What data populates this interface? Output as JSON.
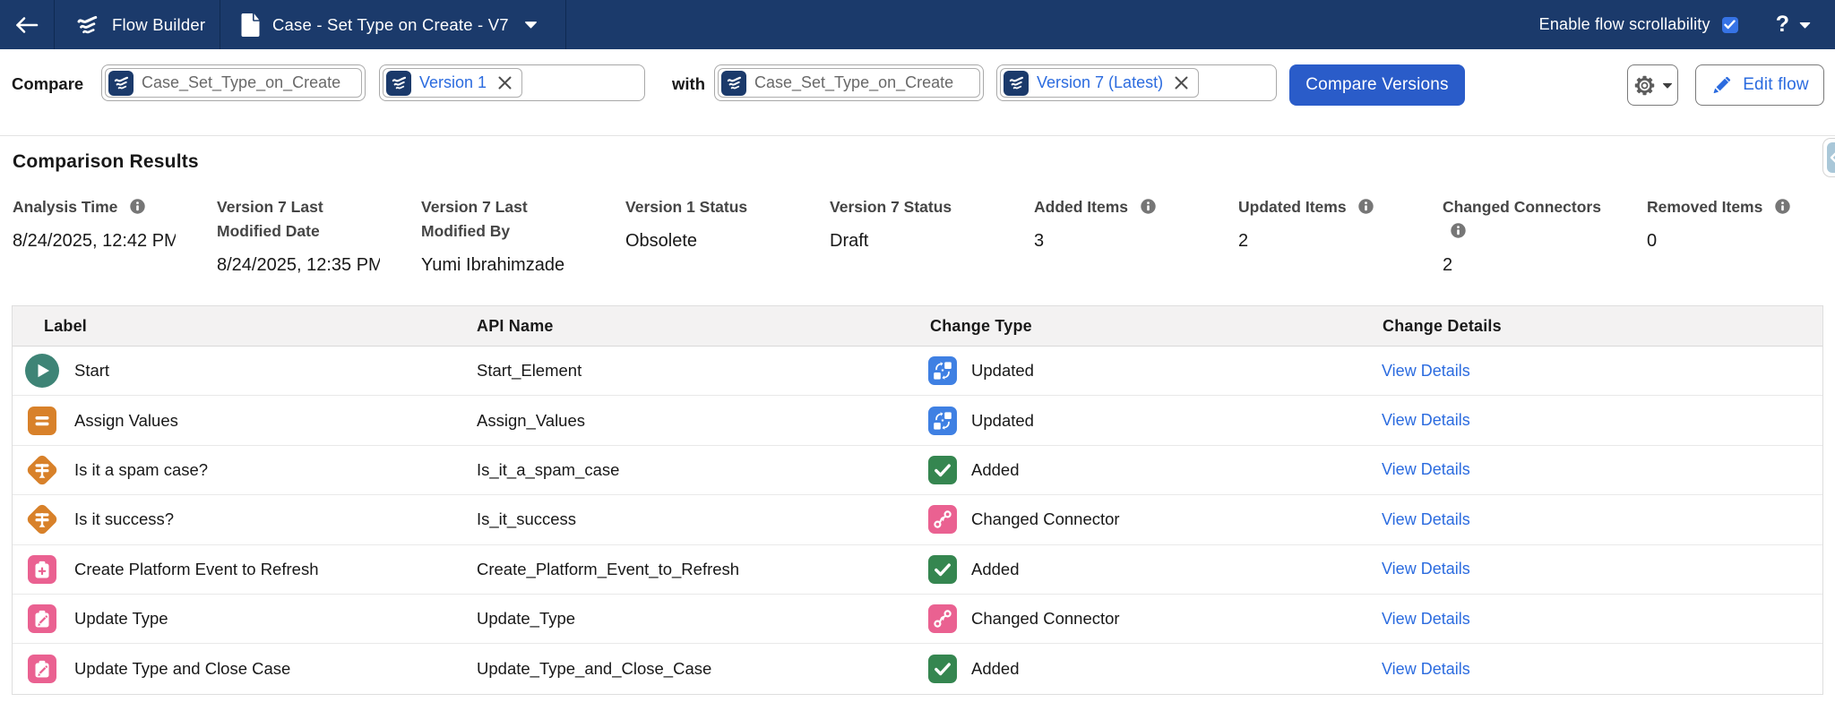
{
  "navbar": {
    "app_name": "Flow Builder",
    "flow_title": "Case - Set Type on Create - V7",
    "scrollability_label": "Enable flow scrollability",
    "scrollability_checked": true,
    "help_label": "?"
  },
  "toolbar": {
    "compare_label": "Compare",
    "with_label": "with",
    "flow_select_1": "Case_Set_Type_on_Create",
    "version_select_1": "Version 1",
    "flow_select_2": "Case_Set_Type_on_Create",
    "version_select_2": "Version 7 (Latest)",
    "compare_button": "Compare Versions",
    "edit_flow_button": "Edit flow"
  },
  "results": {
    "title": "Comparison Results",
    "summary": [
      {
        "label": "Analysis Time",
        "info": true,
        "value": "8/24/2025, 12:42 PM"
      },
      {
        "label": "Version 7 Last Modified Date",
        "info": false,
        "value": "8/24/2025, 12:35 PM"
      },
      {
        "label": "Version 7 Last Modified By",
        "info": false,
        "value": "Yumi Ibrahimzade"
      },
      {
        "label": "Version 1 Status",
        "info": false,
        "value": "Obsolete"
      },
      {
        "label": "Version 7 Status",
        "info": false,
        "value": "Draft"
      },
      {
        "label": "Added Items",
        "info": true,
        "value": "3"
      },
      {
        "label": "Updated Items",
        "info": true,
        "value": "2"
      },
      {
        "label": "Changed Connectors",
        "info": true,
        "value": "2"
      },
      {
        "label": "Removed Items",
        "info": true,
        "value": "0"
      }
    ],
    "table": {
      "columns": [
        "Label",
        "API Name",
        "Change Type",
        "Change Details"
      ],
      "details_link": "View Details",
      "rows": [
        {
          "label": "Start",
          "icon": "start",
          "api_name": "Start_Element",
          "change_type": "Updated",
          "change_icon": "updated"
        },
        {
          "label": "Assign Values",
          "icon": "assignment",
          "api_name": "Assign_Values",
          "change_type": "Updated",
          "change_icon": "updated"
        },
        {
          "label": "Is it a spam case?",
          "icon": "decision",
          "api_name": "Is_it_a_spam_case",
          "change_type": "Added",
          "change_icon": "added"
        },
        {
          "label": "Is it success?",
          "icon": "decision",
          "api_name": "Is_it_success",
          "change_type": "Changed Connector",
          "change_icon": "connector"
        },
        {
          "label": "Create Platform Event to Refresh",
          "icon": "record-create",
          "api_name": "Create_Platform_Event_to_Refresh",
          "change_type": "Added",
          "change_icon": "added"
        },
        {
          "label": "Update Type",
          "icon": "record-update",
          "api_name": "Update_Type",
          "change_type": "Changed Connector",
          "change_icon": "connector"
        },
        {
          "label": "Update Type and Close Case",
          "icon": "record-update",
          "api_name": "Update_Type_and_Close_Case",
          "change_type": "Added",
          "change_icon": "added"
        }
      ]
    }
  },
  "colors": {
    "navy": "#1b3a6b",
    "brand_blue": "#2a5cc9",
    "link_blue": "#2b6bdf",
    "start_teal": "#3e8476",
    "flow_orange": "#d8812a",
    "flow_pink": "#ea6191",
    "updated_blue": "#3f80e3",
    "added_green": "#358650"
  }
}
